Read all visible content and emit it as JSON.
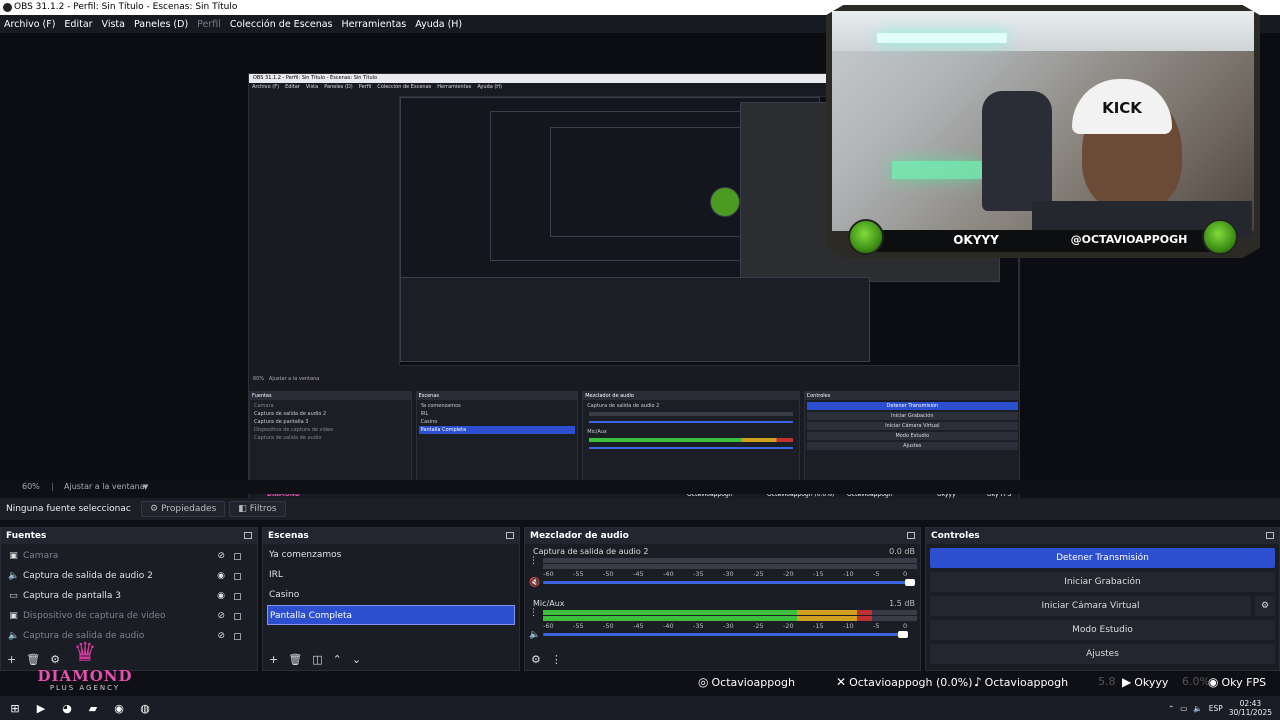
{
  "window": {
    "title": "OBS 31.1.2 - Perfil: Sin Título - Escenas: Sin Título"
  },
  "menu": [
    {
      "label": "Archivo (F)",
      "dim": false
    },
    {
      "label": "Editar",
      "dim": false
    },
    {
      "label": "Vista",
      "dim": false
    },
    {
      "label": "Paneles (D)",
      "dim": false
    },
    {
      "label": "Perfil",
      "dim": true
    },
    {
      "label": "Colección de Escenas",
      "dim": false
    },
    {
      "label": "Herramientas",
      "dim": false
    },
    {
      "label": "Ayuda (H)",
      "dim": false
    }
  ],
  "camera_overlay": {
    "name_left": "OKYYY",
    "name_right": "@OCTAVIOAPPOGH",
    "cap_text": "KICK"
  },
  "nested": {
    "title": "OBS 31.1.2 - Perfil: Sin Título - Escenas: Sin Título",
    "zoom": "60%",
    "fit": "Ajustar a la ventana",
    "no_selection": "Ninguna fuente seleccionada",
    "properties": "Propiedades",
    "filters": "Filtros",
    "logos": [
      "Octavioappogh",
      "Octavioappogh (0.0%)",
      "Octavioappogh",
      "Okyyy",
      "Oky FPS"
    ],
    "clock_time": "02:43",
    "clock_date": "30/11/2025"
  },
  "scale_bar": {
    "zoom": "60%",
    "fit": "Ajustar a la ventana"
  },
  "props_bar": {
    "no_selection": "Ninguna fuente seleccionac",
    "properties": "Propiedades",
    "filters": "Filtros"
  },
  "sources": {
    "title": "Fuentes",
    "items": [
      {
        "label": "Camara",
        "icon": "camera-icon",
        "hidden": true
      },
      {
        "label": "Captura de salida de audio 2",
        "icon": "speaker-icon",
        "hidden": false
      },
      {
        "label": "Captura de pantalla 3",
        "icon": "monitor-icon",
        "hidden": false
      },
      {
        "label": "Dispositivo de captura de video",
        "icon": "camera-icon",
        "hidden": true
      },
      {
        "label": "Captura de salida de audio",
        "icon": "speaker-icon",
        "hidden": true
      }
    ]
  },
  "scenes": {
    "title": "Escenas",
    "items": [
      "Ya comenzamos",
      "IRL",
      "Casino",
      "Pantalla Completa"
    ],
    "selected_index": 3
  },
  "mixer": {
    "title": "Mezclador de audio",
    "channels": [
      {
        "label": "Captura de salida de audio 2",
        "db": "0.0 dB",
        "level": 0.0,
        "muted": true,
        "volume": 1.0
      },
      {
        "label": "Mic/Aux",
        "db": "1.5 dB",
        "level": 0.88,
        "muted": false,
        "volume": 0.98
      }
    ],
    "ticks": [
      "-60",
      "-55",
      "-50",
      "-45",
      "-40",
      "-35",
      "-30",
      "-25",
      "-20",
      "-15",
      "-10",
      "-5",
      "0"
    ]
  },
  "controls": {
    "title": "Controles",
    "buttons": [
      {
        "label": "Detener Transmisión",
        "active": true
      },
      {
        "label": "Iniciar Grabación",
        "active": false
      },
      {
        "label": "Iniciar Cámara Virtual",
        "active": false
      },
      {
        "label": "Modo Estudio",
        "active": false
      },
      {
        "label": "Ajustes",
        "active": false
      }
    ]
  },
  "overlay_logos": {
    "instagram": "Octavioappogh",
    "x": "Octavioappogh (0.0%)",
    "tiktok": "Octavioappogh",
    "youtube": "Okyyy",
    "fps": "Oky FPS",
    "badge_a": "5.8",
    "badge_b": "6.0%"
  },
  "brand": {
    "name": "DIAMOND",
    "sub": "PLUS AGENCY"
  },
  "taskbar": {
    "lang": "ESP",
    "time": "02:43",
    "date": "30/11/2025"
  },
  "colors": {
    "accent": "#2c4fd0",
    "meter_green": "#3cbf3c",
    "meter_yellow": "#d0a020",
    "meter_red": "#c03030",
    "brand_pink": "#e84fb2"
  }
}
